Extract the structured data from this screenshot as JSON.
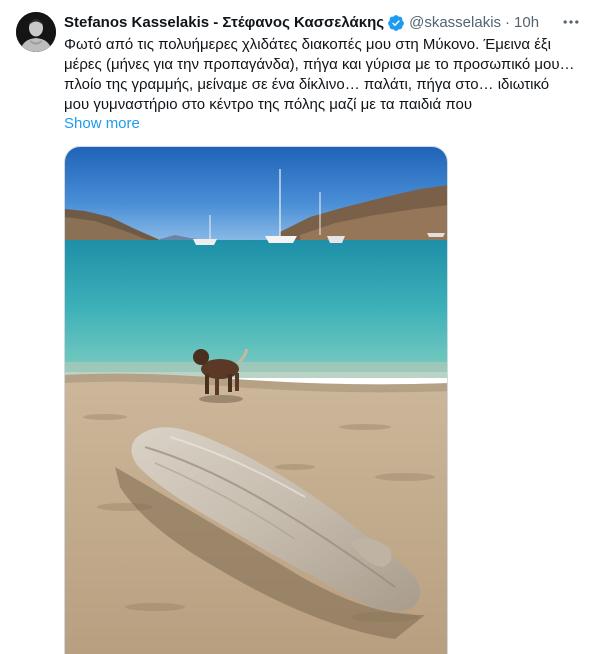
{
  "tweet": {
    "display_name": "Stefanos Kasselakis - Στέφανος Κασσελάκης",
    "handle": "@skasselakis",
    "separator": "·",
    "time": "10h",
    "text_lines": [
      "Φωτό από τις πολυήμερες χλιδάτες διακοπές μου στη Μύκονο. Έμεινα έξι",
      "μέρες (μήνες για την προπαγάνδα), πήγα και γύρισα με το προσωπικό μου…",
      "πλοίο της γραμμής, μείναμε σε ένα δίκλινο… παλάτι, πήγα στο… ιδιωτικό",
      "μου γυμναστήριο στο κέντρο της πόλης μαζί με τα παιδιά που"
    ],
    "show_more_label": "Show more",
    "icons": {
      "verified": "verified-badge-icon",
      "more": "more-options-icon"
    },
    "colors": {
      "accent": "#1d9bf0",
      "secondary_text": "#536471",
      "primary_text": "#0f1419"
    }
  }
}
